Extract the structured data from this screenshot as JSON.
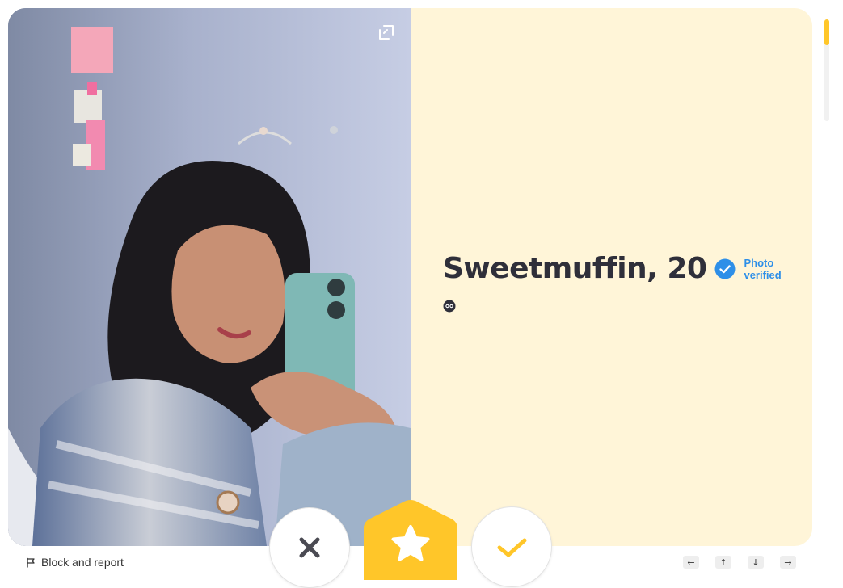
{
  "profile": {
    "name_age": "Sweetmuffin, 20",
    "verified_label": "Photo verified",
    "emoji": "two-dots-emoji"
  },
  "photo": {
    "description_icon": "expand-icon"
  },
  "footer": {
    "block_report_label": "Block and report"
  },
  "actions": {
    "pass_icon": "x-icon",
    "superswipe_icon": "star-icon",
    "like_icon": "check-icon"
  },
  "nav_keys": [
    "←",
    "↑",
    "↓",
    "→"
  ],
  "colors": {
    "accent": "#ffc629",
    "card_bg": "#fff5d8",
    "verified_blue": "#2e8fe8",
    "name_text": "#2f2f3a"
  }
}
